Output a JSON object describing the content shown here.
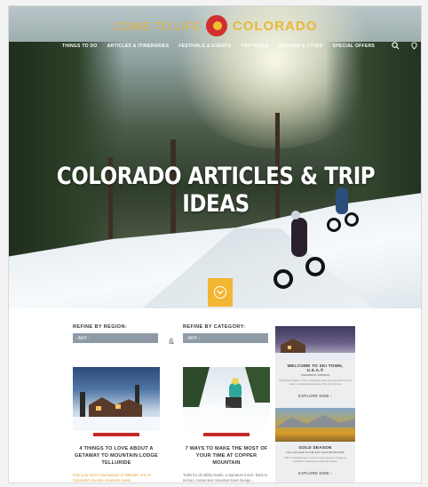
{
  "brand": {
    "tagline": "COME TO LIFE",
    "name": "COLORADO"
  },
  "nav": {
    "items": [
      "THINGS TO DO",
      "ARTICLES & ITINERARIES",
      "FESTIVALS & EVENTS",
      "TRIP IDEAS",
      "REGIONS & CITIES",
      "SPECIAL OFFERS"
    ],
    "icons": [
      {
        "icon": "search-icon",
        "label": ""
      },
      {
        "icon": "map-pin-icon",
        "label": ""
      },
      {
        "icon": "globe-icon",
        "label": ""
      }
    ]
  },
  "hero": {
    "title": "COLORADO ARTICLES & TRIP IDEAS"
  },
  "filters": {
    "region": {
      "label": "REFINE BY REGION:",
      "value": "- ANY -"
    },
    "category": {
      "label": "REFINE BY CATEGORY:",
      "value": "- ANY -"
    },
    "separator": "&"
  },
  "cards": [
    {
      "title": "4 THINGS TO LOVE ABOUT A GETAWAY TO MOUNTAIN LODGE TELLURIDE",
      "desc": "Fine your inner mountaineer at Telluride, one of Colorado's favorite mountain towns."
    },
    {
      "title": "7 WAYS TO MAKE THE MOST OF YOUR TIME AT COPPER MOUNTAIN",
      "desc": "Trails for all ability levels, a signature lunch, back-in terrain, convenient mountain town lounge..."
    }
  ],
  "promos": [
    {
      "title": "WELCOME TO SKI TOWN, U.S.A.®",
      "subtitle": "STEAMBOAT SPRINGS",
      "text": "Steamboat's Western charm, world-class skiing and natural hot springs make it an ideal winter getaway. Plan your trip now.",
      "button": "EXPLORE NOW ›"
    },
    {
      "title": "GOLD SEASON",
      "subtitle": "FALL FOLIAGE IN THE SAN JUAN MOUNTAINS",
      "text": "Take in a kaleidoscope of autumn colors along the byways of Colorado's southwestern peaks this season.",
      "button": "EXPLORE NOW ›"
    }
  ],
  "colors": {
    "accent": "#f2b632",
    "red": "#c62828",
    "filter_bg": "#8e9ba6"
  }
}
